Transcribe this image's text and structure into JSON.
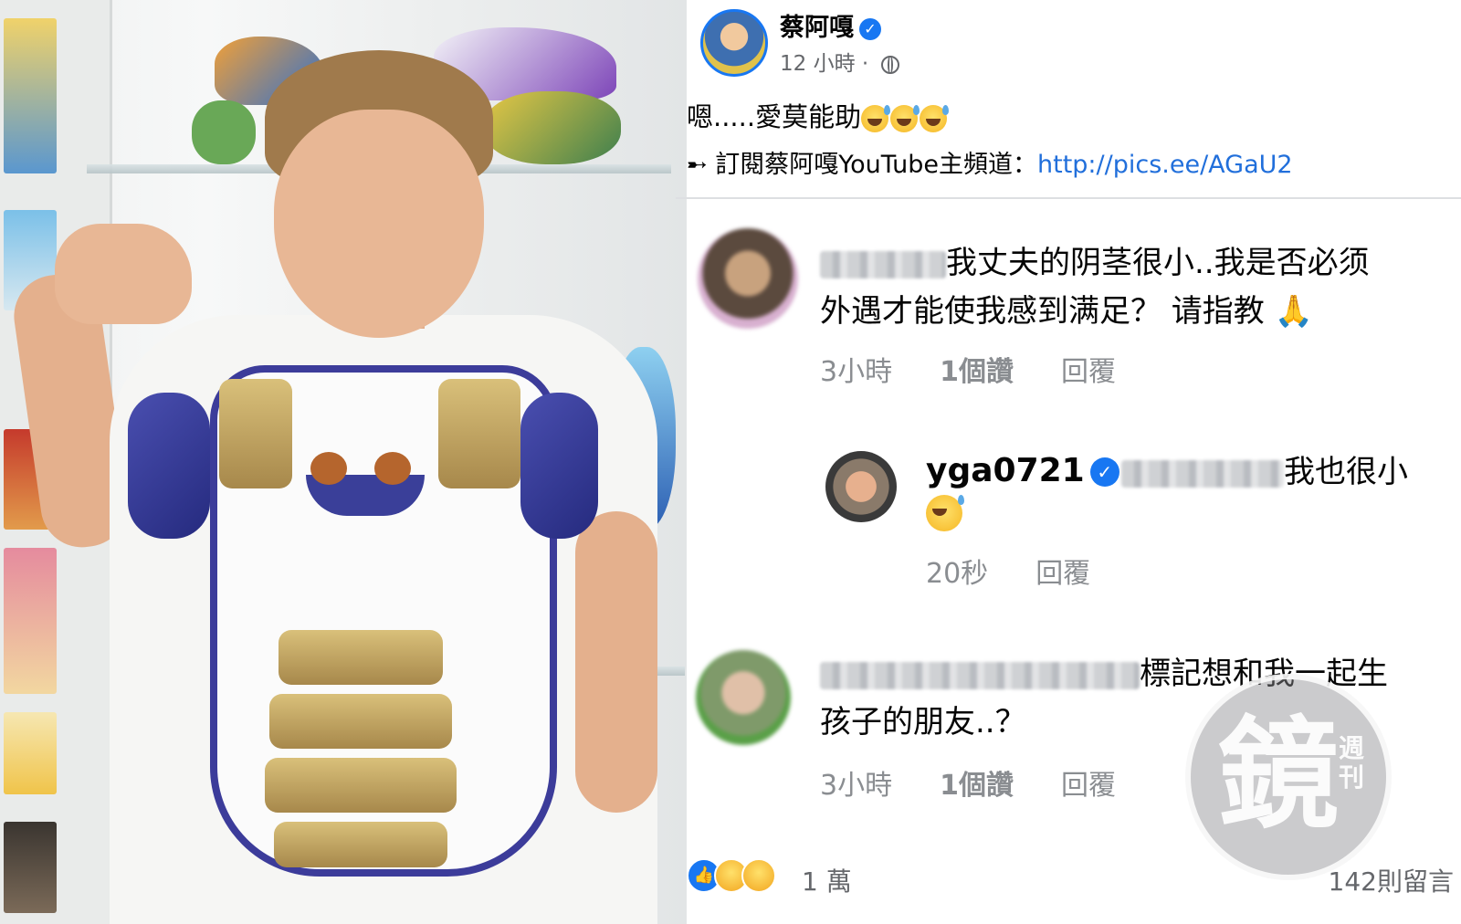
{
  "post": {
    "author": "蔡阿嘎",
    "time": "12 小時",
    "separator": "·",
    "text": "嗯.....愛莫能助",
    "link_prefix": "➸ 訂閱蔡阿嘎YouTube主頻道：",
    "link_url": "http://pics.ee/AGaU2"
  },
  "comments": [
    {
      "text_line1": "我丈夫的阴茎很小..我是否必须",
      "text_line2": "外遇才能使我感到满足？ 请指教 🙏",
      "time": "3小時",
      "likes": "1個讚",
      "reply": "回覆"
    },
    {
      "username": "yga0721",
      "text": "我也很小",
      "time": "20秒",
      "reply": "回覆"
    },
    {
      "text_line1": "標記想和我一起生",
      "text_line2": "孩子的朋友..？",
      "time": "3小時",
      "likes": "1個讚",
      "reply": "回覆"
    }
  ],
  "footer": {
    "reaction_count": "1 萬",
    "comments_count": "142則留言"
  },
  "watermark": {
    "main": "鏡",
    "sub": "週刊"
  },
  "colors": {
    "link": "#216fdb",
    "verified": "#1877f2",
    "meta": "#8a8d91"
  }
}
